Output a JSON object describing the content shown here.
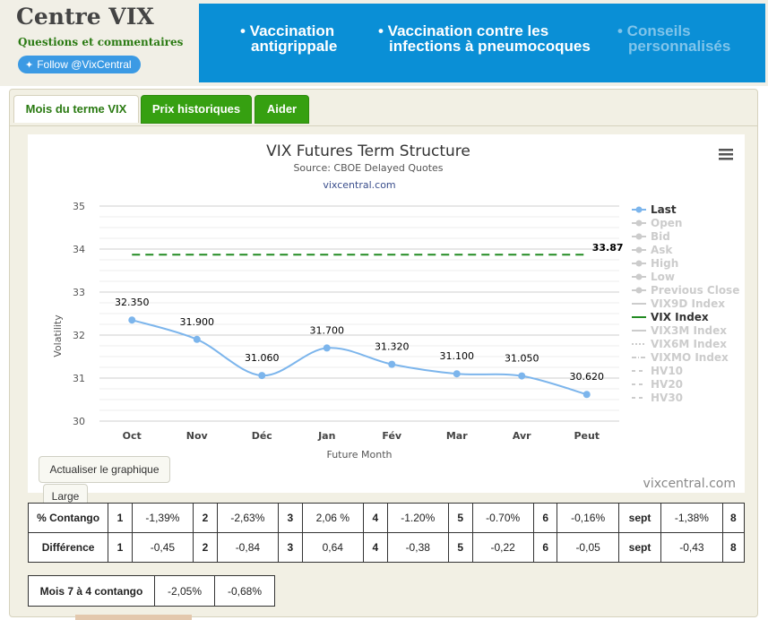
{
  "site": {
    "title": "Centre VIX",
    "subtitle": "Questions et commentaires",
    "follow_label": "Follow @VixCentral",
    "follow_icon": "twitter-bird-icon"
  },
  "banner": {
    "color": "#0a8fd6",
    "items": [
      {
        "line1": "• Vaccination",
        "line2": "antigrippale"
      },
      {
        "line1": "• Vaccination contre les",
        "line2": "infections à pneumocoques"
      },
      {
        "line1": "• Conseils",
        "line2": "personnalisés"
      }
    ]
  },
  "tabs": [
    {
      "label": "Mois du terme VIX"
    },
    {
      "label": "Prix historiques"
    },
    {
      "label": "Aider"
    }
  ],
  "chart_data": {
    "type": "line",
    "title": "VIX Futures Term Structure",
    "subtitle": "Source: CBOE Delayed Quotes",
    "credit_top": "vixcentral.com",
    "credit_bottom": "vixcentral.com",
    "xlabel": "Future Month",
    "ylabel": "Volatility",
    "ylim": [
      30,
      35
    ],
    "yticks": [
      "30",
      "31",
      "32",
      "33",
      "34",
      "35"
    ],
    "categories": [
      "Oct",
      "Nov",
      "Déc",
      "Jan",
      "Fév",
      "Mar",
      "Avr",
      "Peut"
    ],
    "grid": true,
    "legend_placement": "right",
    "series": [
      {
        "name": "Last",
        "color": "#7cb5ec",
        "values": [
          32.35,
          31.9,
          31.06,
          31.7,
          31.32,
          31.1,
          31.05,
          30.62
        ],
        "labels": [
          "32.350",
          "31.900",
          "31.060",
          "31.700",
          "31.320",
          "31.100",
          "31.050",
          "30.620"
        ]
      },
      {
        "name": "VIX Index",
        "color": "#228b22",
        "dashed": true,
        "constant": 33.87,
        "label": "33.87"
      }
    ],
    "legend": [
      {
        "name": "Last",
        "active": true,
        "symbol": "dot"
      },
      {
        "name": "Open",
        "active": false,
        "symbol": "diamond"
      },
      {
        "name": "Bid",
        "active": false,
        "symbol": "square"
      },
      {
        "name": "Ask",
        "active": false,
        "symbol": "triangle"
      },
      {
        "name": "High",
        "active": false,
        "symbol": "triangle-down"
      },
      {
        "name": "Low",
        "active": false,
        "symbol": "dot"
      },
      {
        "name": "Previous Close",
        "active": false,
        "symbol": "diamond"
      },
      {
        "name": "VIX9D Index",
        "active": false,
        "symbol": "line"
      },
      {
        "name": "VIX Index",
        "active": true,
        "symbol": "line"
      },
      {
        "name": "VIX3M Index",
        "active": false,
        "symbol": "line"
      },
      {
        "name": "VIX6M Index",
        "active": false,
        "symbol": "dotted"
      },
      {
        "name": "VIXMO Index",
        "active": false,
        "symbol": "dash-dot"
      },
      {
        "name": "HV10",
        "active": false,
        "symbol": "dash"
      },
      {
        "name": "HV20",
        "active": false,
        "symbol": "dash"
      },
      {
        "name": "HV30",
        "active": false,
        "symbol": "dash"
      }
    ]
  },
  "controls": {
    "refresh_label": "Actualiser le graphique",
    "size_label": "Large",
    "menu_icon": "hamburger-menu-icon"
  },
  "contango_table": {
    "rows": [
      {
        "header": "% Contango",
        "cells": [
          "1",
          "-1,39%",
          "2",
          "-2,63%",
          "3",
          "2,06 %",
          "4",
          "-1.20%",
          "5",
          "-0.70%",
          "6",
          "-0,16%",
          "sept",
          "-1,38%",
          "8"
        ]
      },
      {
        "header": "Différence",
        "cells": [
          "1",
          "-0,45",
          "2",
          "-0,84",
          "3",
          "0,64",
          "4",
          "-0,38",
          "5",
          "-0,22",
          "6",
          "-0,05",
          "sept",
          "-0,43",
          "8"
        ]
      }
    ]
  },
  "summary_table": {
    "header": "Mois 7 à 4 contango",
    "values": [
      "-2,05%",
      "-0,68%"
    ]
  }
}
